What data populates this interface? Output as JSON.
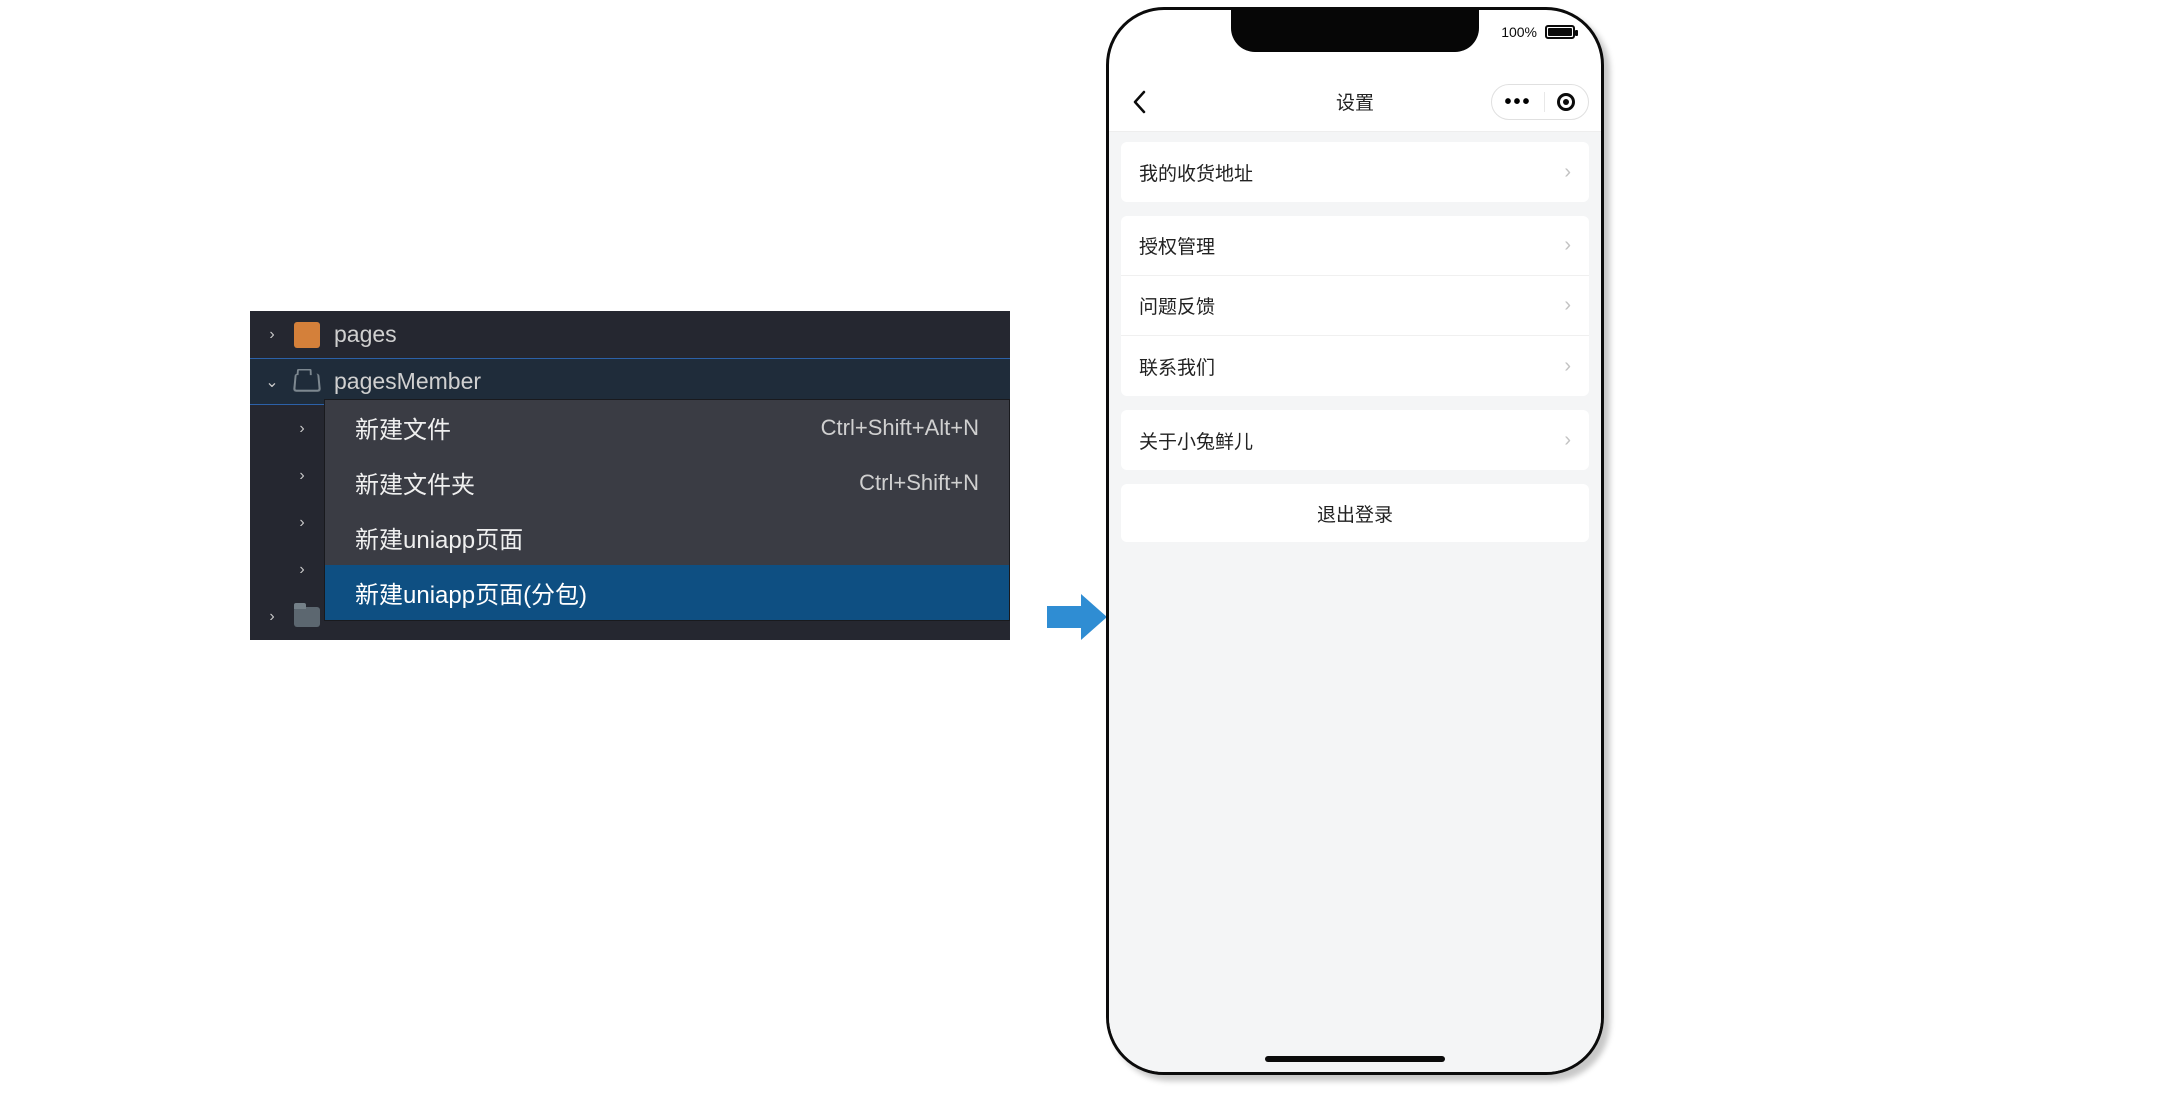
{
  "editor": {
    "tree": [
      {
        "label": "pages",
        "iconType": "orange",
        "chev": "›"
      },
      {
        "label": "pagesMember",
        "iconType": "folder-open",
        "chev": "⌄",
        "selected": true
      }
    ],
    "ghostItems": [
      "",
      "",
      "",
      "",
      ""
    ]
  },
  "contextMenu": {
    "items": [
      {
        "label": "新建文件",
        "shortcut": "Ctrl+Shift+Alt+N"
      },
      {
        "label": "新建文件夹",
        "shortcut": "Ctrl+Shift+N"
      },
      {
        "label": "新建uniapp页面",
        "shortcut": ""
      },
      {
        "label": "新建uniapp页面(分包)",
        "shortcut": "",
        "highlight": true
      }
    ]
  },
  "arrow": {
    "color": "#2f8dd3"
  },
  "phone": {
    "battery": "100%",
    "title": "设置",
    "group1": [
      "我的收货地址"
    ],
    "group2": [
      "授权管理",
      "问题反馈",
      "联系我们"
    ],
    "group3": [
      "关于小兔鲜儿"
    ],
    "logout": "退出登录"
  }
}
